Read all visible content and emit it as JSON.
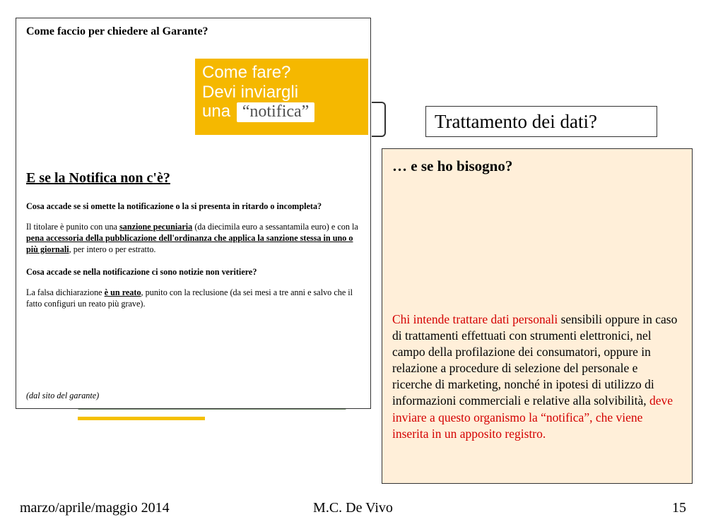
{
  "left": {
    "title": "Come faccio per chiedere al Garante?",
    "orange_line1": "Come fare?",
    "orange_line2": "Devi inviargli",
    "orange_line3_prefix": "una",
    "orange_chip": "“notifica”",
    "sub_heading": "E se la Notifica non c'è?",
    "q1": "Cosa accade se si omette la notificazione o la si presenta in ritardo o incompleta?",
    "a1_pre": "Il titolare è punito con una ",
    "a1_u1": "sanzione pecuniaria",
    "a1_mid": " (da diecimila euro a sessantamila euro) e con la ",
    "a1_u2": "pena accessoria della pubblicazione dell'ordinanza che applica la sanzione stessa in uno o più giornali",
    "a1_post": ", per intero o per estratto.",
    "q2": "Cosa accade se nella notificazione ci sono notizie non veritiere?",
    "a2_pre": "La falsa dichiarazione ",
    "a2_u": "è un reato",
    "a2_post": ", punito con la reclusione (da sei mesi a tre anni e salvo che il fatto configuri un reato più grave).",
    "source_note": "(dal sito del garante)"
  },
  "right": {
    "title_box": "Trattamento dei dati?",
    "subtitle": "… e se ho bisogno?",
    "body_red1": "Chi intende trattare dati personali",
    "body_black": " sensibili oppure in caso di trattamenti effettuati con strumenti elettronici, nel campo della profilazione dei consumatori, oppure in relazione a procedure di selezione del personale e ricerche di marketing, nonché in ipotesi di utilizzo di informazioni commerciali e relative alla solvibilità, ",
    "body_red2": "deve inviare a questo organismo la “notifica”, che viene inserita in un apposito registro."
  },
  "footer": {
    "left": "marzo/aprile/maggio 2014",
    "center": "M.C. De Vivo",
    "right": "15"
  }
}
